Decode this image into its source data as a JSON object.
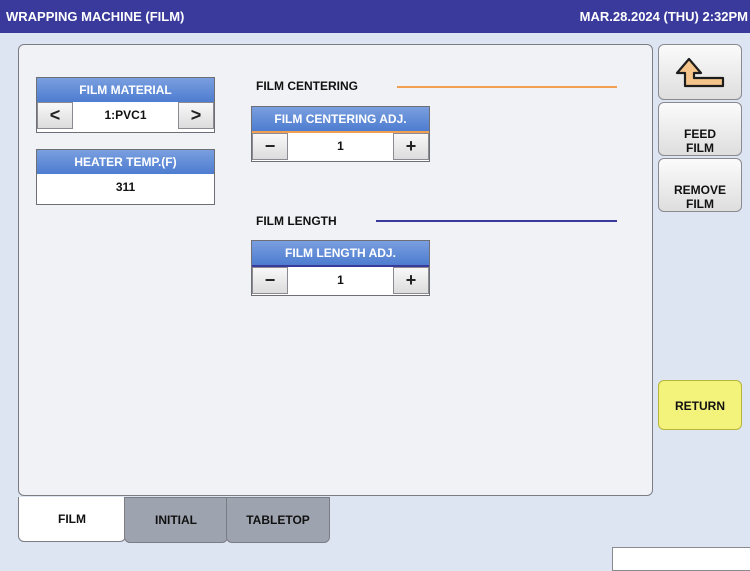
{
  "header": {
    "title": "WRAPPING MACHINE (FILM)",
    "datetime": "MAR.28.2024 (THU)  2:32PM"
  },
  "film_material": {
    "label": "FILM MATERIAL",
    "value": "1:PVC1",
    "prev_symbol": "<",
    "next_symbol": ">"
  },
  "heater_temp": {
    "label": "HEATER TEMP.(F)",
    "value": "311"
  },
  "film_centering": {
    "section_label": "FILM CENTERING",
    "adj_label": "FILM CENTERING ADJ.",
    "value": "1",
    "minus_symbol": "−",
    "plus_symbol": "+",
    "line_color": "#f0a050"
  },
  "film_length": {
    "section_label": "FILM LENGTH",
    "adj_label": "FILM LENGTH ADJ.",
    "value": "1",
    "minus_symbol": "−",
    "plus_symbol": "+",
    "line_color": "#3a3a9c"
  },
  "sidebar": {
    "back_icon": "return-arrow-icon",
    "feed_film": "FEED\nFILM",
    "remove_film": "REMOVE\nFILM",
    "return_label": "RETURN"
  },
  "tabs": [
    {
      "label": "FILM",
      "active": true
    },
    {
      "label": "INITIAL",
      "active": false
    },
    {
      "label": "TABLETOP",
      "active": false
    }
  ]
}
